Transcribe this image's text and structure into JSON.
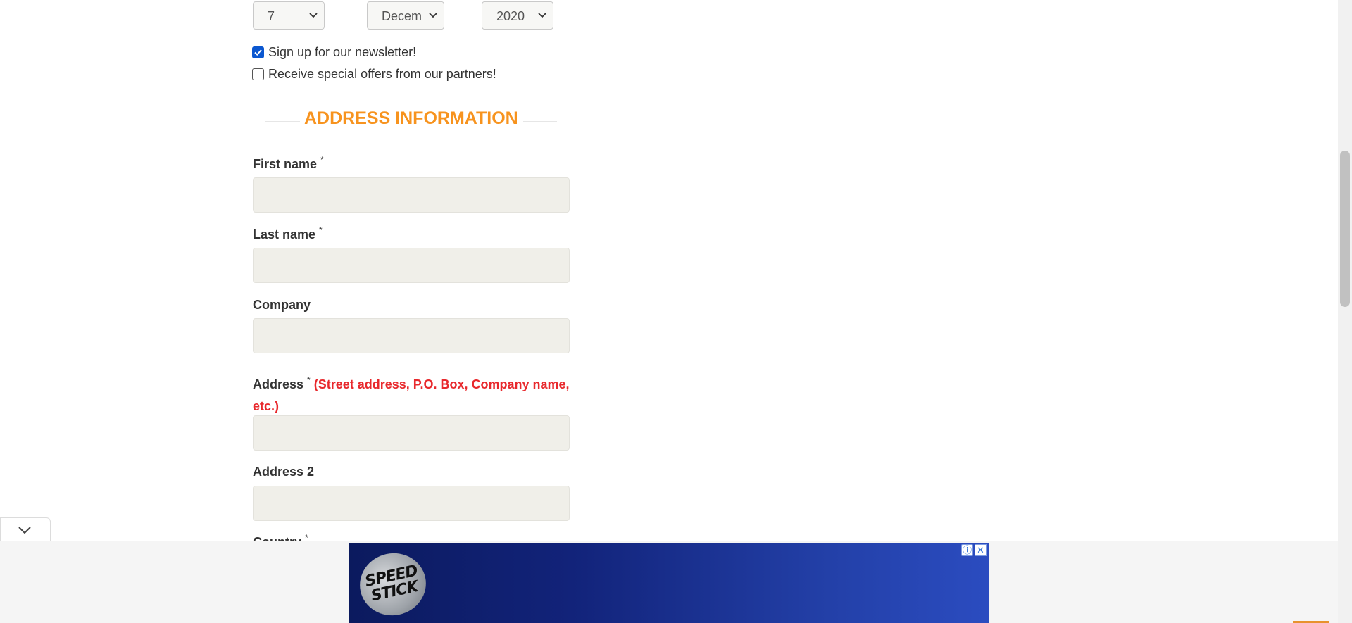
{
  "birthdate": {
    "day": "7",
    "month": "Decem",
    "year": "2020"
  },
  "options": {
    "newsletter": {
      "label": "Sign up for our newsletter!",
      "checked": true
    },
    "partners": {
      "label": "Receive special offers from our partners!",
      "checked": false
    }
  },
  "address_section": {
    "title": "ADDRESS INFORMATION",
    "first_name_label": "First name",
    "last_name_label": "Last name",
    "company_label": "Company",
    "address_label": "Address",
    "address_hint": "(Street address, P.O. Box, Company name, etc.)",
    "address2_label": "Address 2",
    "country_label": "Country",
    "required_mark": "*"
  },
  "colors": {
    "heading": "#f7931e",
    "hint": "#e8292d",
    "input_bg": "#f0efe9",
    "checkbox_checked": "#0b57d0"
  },
  "ad": {
    "logo_line1": "SPEED",
    "logo_line2": "STICK",
    "info_icon": "ⓘ",
    "close_icon": "✕"
  },
  "icons": [
    "chevron-down-icon",
    "checkmark-icon",
    "collapse-chevron-icon",
    "ad-info-icon",
    "ad-close-icon"
  ]
}
